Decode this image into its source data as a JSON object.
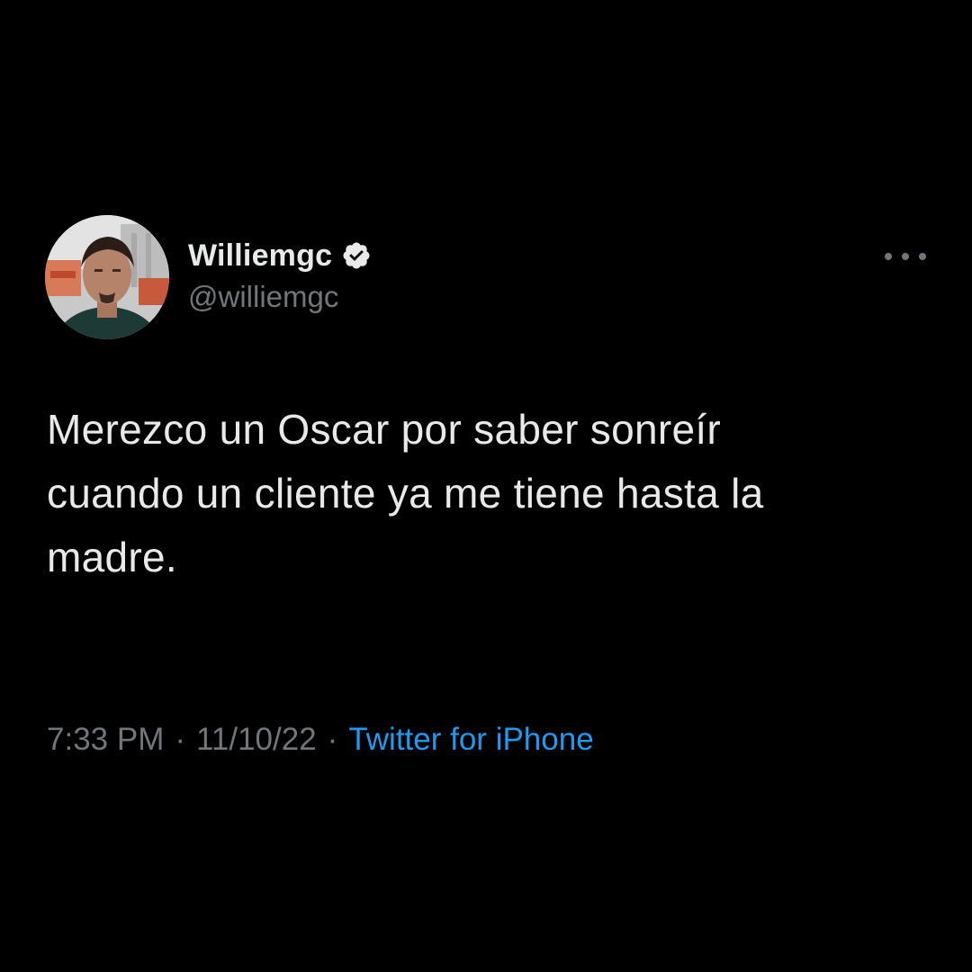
{
  "tweet": {
    "author": {
      "display_name": "Williemgc",
      "handle": "@williemgc",
      "verified": true,
      "avatar_icon": "user-avatar"
    },
    "more_icon": "more-horizontal-icon",
    "text": "Merezco un Oscar por saber sonreír\ncuando un cliente ya me tiene hasta la\nmadre.",
    "time": "7:33 PM",
    "separator": "·",
    "date": "11/10/22",
    "source": "Twitter for iPhone"
  },
  "colors": {
    "background": "#000000",
    "primary_text": "#e7e9ea",
    "secondary_text": "#71767b",
    "accent": "#1d9bf0"
  }
}
